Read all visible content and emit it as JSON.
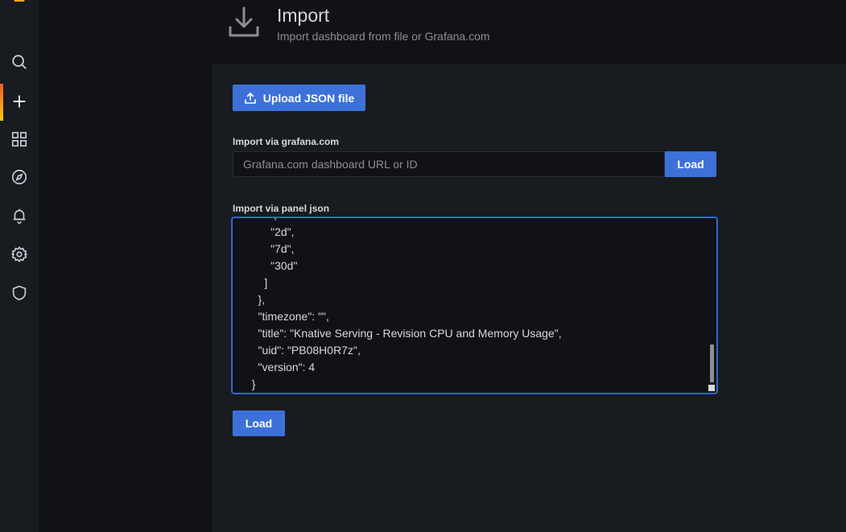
{
  "header": {
    "title": "Import",
    "subtitle": "Import dashboard from file or Grafana.com"
  },
  "sidebar": {
    "items": [
      {
        "icon": "search-icon"
      },
      {
        "icon": "plus-icon",
        "active": true
      },
      {
        "icon": "dashboards-grid-icon"
      },
      {
        "icon": "compass-icon"
      },
      {
        "icon": "bell-icon"
      },
      {
        "icon": "gear-icon"
      },
      {
        "icon": "shield-icon"
      }
    ]
  },
  "upload": {
    "label": "Upload JSON file"
  },
  "grafana_com": {
    "label": "Import via grafana.com",
    "placeholder": "Grafana.com dashboard URL or ID",
    "load_label": "Load"
  },
  "panel_json": {
    "label": "Import via panel json",
    "content": "         ,\n        \"2d\",\n        \"7d\",\n        \"30d\"\n      ]\n    },\n    \"timezone\": \"\",\n    \"title\": \"Knative Serving - Revision CPU and Memory Usage\",\n    \"uid\": \"PB08H0R7z\",\n    \"version\": 4\n  }"
  },
  "footer": {
    "load_label": "Load"
  },
  "colors": {
    "accent": "#3d71d9",
    "sidebar_bg": "#181b1f",
    "page_bg": "#111217",
    "active_indicator": "#f05a28"
  }
}
